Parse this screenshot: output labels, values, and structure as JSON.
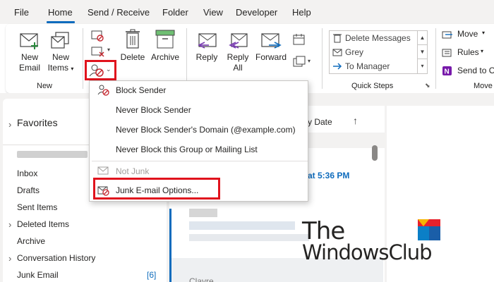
{
  "menu": {
    "items": [
      "File",
      "Home",
      "Send / Receive",
      "Folder",
      "View",
      "Developer",
      "Help"
    ],
    "active": "Home"
  },
  "ribbon": {
    "new_email": [
      "New",
      "Email"
    ],
    "new_items": [
      "New",
      "Items"
    ],
    "delete": "Delete",
    "archive": "Archive",
    "reply": "Reply",
    "reply_all": [
      "Reply",
      "All"
    ],
    "forward": "Forward",
    "group_new": "New",
    "quick_steps": {
      "items": [
        "Delete Messages",
        "Grey",
        "To Manager"
      ],
      "label": "Quick Steps"
    },
    "move": "Move",
    "rules": "Rules",
    "send_to_onenote": "Send to O",
    "group_move": "Move"
  },
  "nav": {
    "favorites": "Favorites",
    "folders": [
      {
        "label": "Inbox",
        "expandable": false
      },
      {
        "label": "Drafts",
        "expandable": false
      },
      {
        "label": "Sent Items",
        "expandable": false
      },
      {
        "label": "Deleted Items",
        "expandable": true
      },
      {
        "label": "Archive",
        "expandable": false
      },
      {
        "label": "Conversation History",
        "expandable": true
      },
      {
        "label": "Junk Email",
        "expandable": false
      }
    ],
    "junk_count": "[6]"
  },
  "list": {
    "sort_label": "y Date",
    "sort_arrow": "↑",
    "time_snippet": "at 5:36 PM",
    "bottom_snippet": "Clayre"
  },
  "dropdown": {
    "block_sender": "Block Sender",
    "never_block_sender": "Never Block Sender",
    "never_block_domain": "Never Block Sender's Domain (@example.com)",
    "never_block_group": "Never Block this Group or Mailing List",
    "not_junk": "Not Junk",
    "junk_options": "Junk E-mail Options..."
  },
  "watermark": {
    "line1": "The",
    "line2": "WindowsClub"
  },
  "colors": {
    "accent": "#0f6cbd",
    "highlight_box": "#e0131d",
    "disabled_text": "#a19f9d"
  }
}
